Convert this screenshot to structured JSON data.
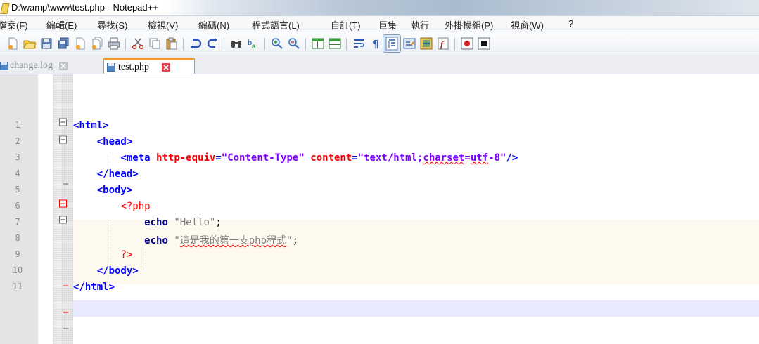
{
  "window": {
    "title": "D:\\wamp\\www\\test.php - Notepad++"
  },
  "menu": [
    "檔案(F)",
    "編輯(E)",
    "尋找(S)",
    "檢視(V)",
    "編碼(N)",
    "程式語言(L)",
    "自訂(T)",
    "巨集",
    "執行",
    "外掛模組(P)",
    "視窗(W)",
    "?"
  ],
  "toolbar": {
    "buttons": [
      "new-file",
      "open-file",
      "save",
      "save-all",
      "close",
      "close-all",
      "print",
      "cut",
      "copy",
      "paste",
      "undo",
      "redo",
      "find",
      "replace",
      "zoom-in",
      "zoom-out",
      "sync-vertical-scroll",
      "sync-horizontal-scroll",
      "word-wrap",
      "show-all-characters",
      "indent-guide",
      "user-defined-language",
      "document-map",
      "function-list",
      "record-macro",
      "stop-recording"
    ],
    "active_button": "indent-guide"
  },
  "tabs": [
    {
      "label": "change.log",
      "active": false
    },
    {
      "label": "test.php",
      "active": true
    }
  ],
  "editor": {
    "current_line": 10,
    "lines": [
      {
        "n": "1",
        "text": "<html>"
      },
      {
        "n": "2",
        "text": "    <head>"
      },
      {
        "n": "3",
        "text": "        <meta http-equiv=\"Content-Type\" content=\"text/html;charset=utf-8\"/>"
      },
      {
        "n": "4",
        "text": "    </head>"
      },
      {
        "n": "5",
        "text": "    <body>"
      },
      {
        "n": "6",
        "text": "        <?php"
      },
      {
        "n": "7",
        "text": "            echo \"Hello\";"
      },
      {
        "n": "8",
        "text": "            echo \"這是我的第一支php程式\";"
      },
      {
        "n": "9",
        "text": "        ?>"
      },
      {
        "n": "10",
        "text": "    </body>"
      },
      {
        "n": "11",
        "text": "</html>"
      }
    ]
  },
  "colors": {
    "html_tag": "#0000ff",
    "html_attribute": "#ff0000",
    "html_attr_value": "#8000ff",
    "php_delimiter": "#ff0000",
    "php_keyword": "#000080",
    "php_string": "#808080",
    "php_block_background": "#fef9ef",
    "current_line_background": "#e8e8ff",
    "active_tab_accent": "#f59a2b"
  }
}
